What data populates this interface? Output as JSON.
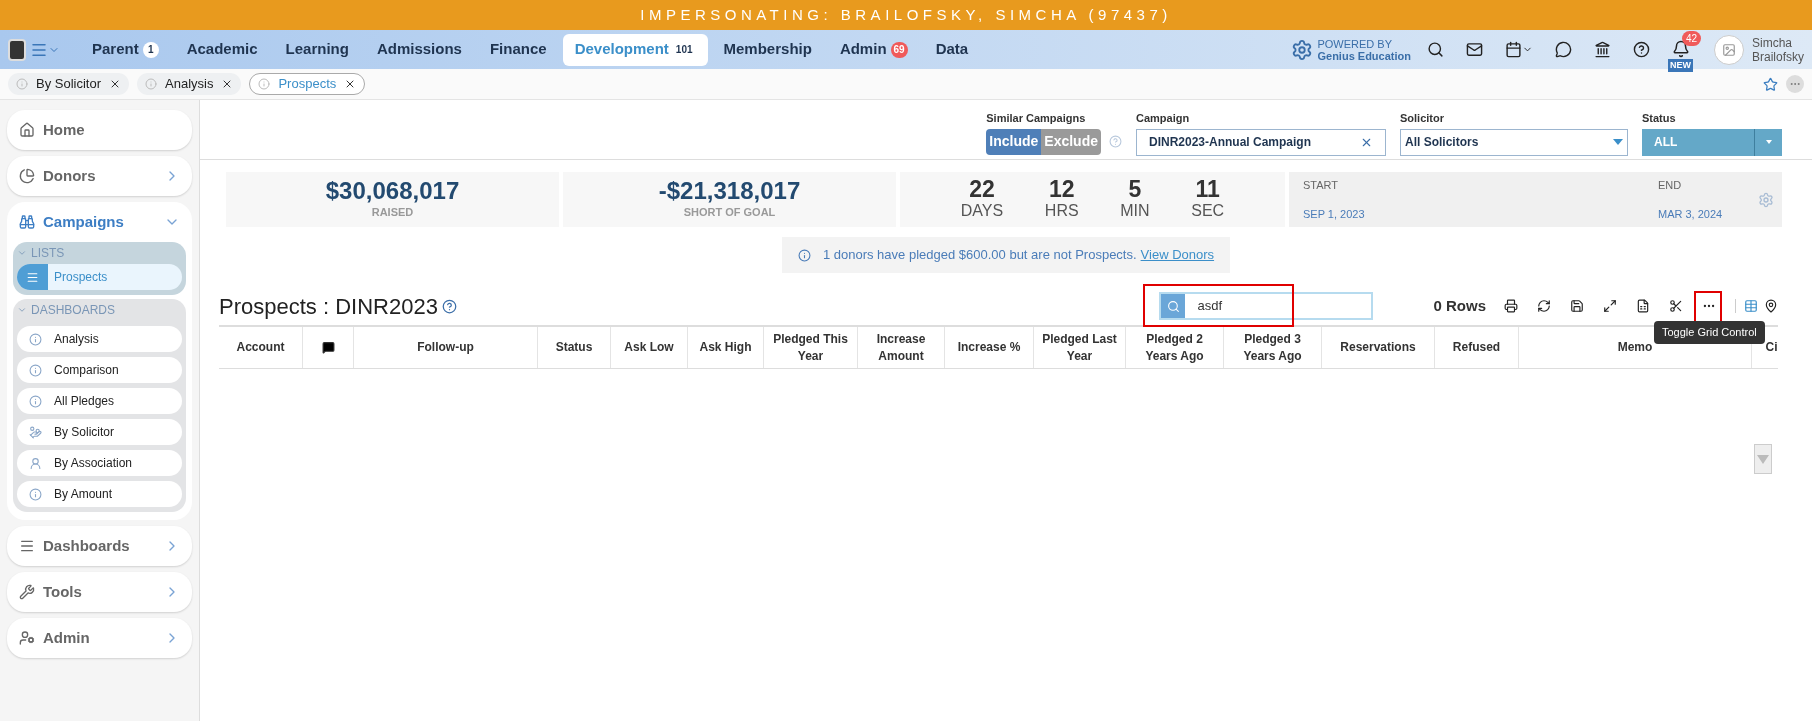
{
  "banner": "IMPERSONATING: BRAILOFSKY, SIMCHA (97437)",
  "nav": [
    {
      "label": "Parent",
      "badge": {
        "text": "1",
        "kind": "plain"
      },
      "selected": false
    },
    {
      "label": "Academic",
      "selected": false
    },
    {
      "label": "Learning",
      "selected": false
    },
    {
      "label": "Admissions",
      "selected": false
    },
    {
      "label": "Finance",
      "selected": false
    },
    {
      "label": "Development",
      "badge": {
        "text": "101",
        "kind": "plain"
      },
      "selected": true
    },
    {
      "label": "Membership",
      "selected": false
    },
    {
      "label": "Admin",
      "badge": {
        "text": "69",
        "kind": "alert"
      },
      "selected": false
    },
    {
      "label": "Data",
      "selected": false
    }
  ],
  "powered": {
    "line1": "POWERED BY",
    "line2": "Genius Education"
  },
  "notifications": {
    "count": "42",
    "tag": "NEW"
  },
  "user": {
    "first": "Simcha",
    "last": "Brailofsky"
  },
  "open_tabs": [
    {
      "label": "By Solicitor",
      "selected": false
    },
    {
      "label": "Analysis",
      "selected": false
    },
    {
      "label": "Prospects",
      "selected": true
    }
  ],
  "sidebar": [
    {
      "label": "Home",
      "kind": "link",
      "expanded": false
    },
    {
      "label": "Donors",
      "kind": "section",
      "expanded": false
    },
    {
      "label": "Campaigns",
      "kind": "section",
      "expanded": true,
      "groups": [
        {
          "title": "LISTS",
          "kind": "lists",
          "items": [
            {
              "label": "Prospects",
              "kind": "list",
              "selected": true
            }
          ]
        },
        {
          "title": "DASHBOARDS",
          "kind": "dashboards",
          "items": [
            {
              "label": "Analysis",
              "kind": "info",
              "selected": false
            },
            {
              "label": "Comparison",
              "kind": "info",
              "selected": false
            },
            {
              "label": "All Pledges",
              "kind": "info",
              "selected": false
            },
            {
              "label": "By Solicitor",
              "kind": "hand",
              "selected": false
            },
            {
              "label": "By Association",
              "kind": "person",
              "selected": false
            },
            {
              "label": "By Amount",
              "kind": "info",
              "selected": false
            }
          ]
        }
      ]
    },
    {
      "label": "Dashboards",
      "kind": "section",
      "expanded": false
    },
    {
      "label": "Tools",
      "kind": "section",
      "expanded": false
    },
    {
      "label": "Admin",
      "kind": "section",
      "expanded": false
    }
  ],
  "filters": {
    "similar_label": "Similar Campaigns",
    "include": {
      "label": "Include",
      "selected": true
    },
    "exclude": {
      "label": "Exclude",
      "selected": false
    },
    "campaign_label": "Campaign",
    "campaign_value": "DINR2023-Annual Campaign",
    "solicitor_label": "Solicitor",
    "solicitor_value": "All Solicitors",
    "status_label": "Status",
    "status_value": "ALL"
  },
  "stats": [
    {
      "value": "$30,068,017",
      "label": "RAISED"
    },
    {
      "value": "-$21,318,017",
      "label": "SHORT OF GOAL"
    }
  ],
  "countdown": [
    {
      "value": "22",
      "unit": "DAYS"
    },
    {
      "value": "12",
      "unit": "HRS"
    },
    {
      "value": "5",
      "unit": "MIN"
    },
    {
      "value": "11",
      "unit": "SEC"
    }
  ],
  "dates": {
    "start_label": "START",
    "start": "SEP 1, 2023",
    "end_label": "END",
    "end": "MAR 3, 2024"
  },
  "notice": {
    "text": "1 donors have pledged $600.00 but are not Prospects.",
    "link": "View Donors"
  },
  "grid": {
    "title": "Prospects : DINR2023",
    "search_value": "asdf",
    "rows": "0 Rows",
    "tooltip": "Toggle Grid Control",
    "columns": [
      "Account",
      "",
      "Follow-up",
      "Status",
      "Ask Low",
      "Ask High",
      "Pledged This Year",
      "Increase Amount",
      "Increase %",
      "Pledged Last Year",
      "Pledged 2 Years Ago",
      "Pledged 3 Years Ago",
      "Reservations",
      "Refused",
      "Memo",
      "Ci"
    ]
  }
}
